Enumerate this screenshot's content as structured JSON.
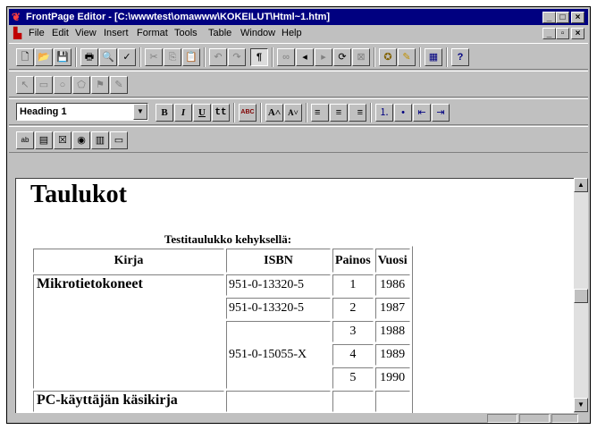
{
  "window": {
    "title": "FrontPage Editor - [C:\\wwwtest\\omawww\\KOKEILUT\\Html~1.htm]",
    "controls": {
      "minimize": "_",
      "maximize": "□",
      "close": "×"
    }
  },
  "menu": {
    "items": [
      "File",
      "Edit",
      "View",
      "Insert",
      "Format",
      "Tools",
      "Table",
      "Window",
      "Help"
    ],
    "doc_controls": {
      "minimize": "_",
      "restore": "▫",
      "close": "×"
    }
  },
  "toolbar_standard": [
    {
      "name": "new-icon",
      "glyph": "🗋"
    },
    {
      "name": "open-icon",
      "glyph": "📂"
    },
    {
      "name": "save-icon",
      "glyph": "💾"
    },
    {
      "name": "print-icon",
      "glyph": "🖶"
    },
    {
      "name": "print-preview-icon",
      "glyph": "🔍"
    },
    {
      "name": "spelling-icon",
      "glyph": "✓"
    },
    {
      "name": "cut-icon",
      "glyph": "✂"
    },
    {
      "name": "copy-icon",
      "glyph": "⎘"
    },
    {
      "name": "paste-icon",
      "glyph": "📋"
    },
    {
      "name": "undo-icon",
      "glyph": "↶"
    },
    {
      "name": "redo-icon",
      "glyph": "↷"
    },
    {
      "name": "show-marks-icon",
      "glyph": "¶"
    },
    {
      "name": "link-icon",
      "glyph": "∞"
    },
    {
      "name": "back-icon",
      "glyph": "◂"
    },
    {
      "name": "forward-icon",
      "glyph": "▸"
    },
    {
      "name": "refresh-icon",
      "glyph": "⟳"
    },
    {
      "name": "stop-icon",
      "glyph": "⊠"
    },
    {
      "name": "explorer-icon",
      "glyph": "✪"
    },
    {
      "name": "editor-icon",
      "glyph": "✎"
    },
    {
      "name": "table-icon",
      "glyph": "▦"
    },
    {
      "name": "help-icon",
      "glyph": "?"
    }
  ],
  "toolbar_image": [
    {
      "name": "pointer-icon",
      "glyph": "↖"
    },
    {
      "name": "rectangle-icon",
      "glyph": "▭"
    },
    {
      "name": "circle-icon",
      "glyph": "○"
    },
    {
      "name": "polygon-icon",
      "glyph": "⬠"
    },
    {
      "name": "highlight-hotspots-icon",
      "glyph": "⚑"
    },
    {
      "name": "make-transparent-icon",
      "glyph": "✎"
    }
  ],
  "toolbar_format": {
    "style_value": "Heading 1",
    "buttons": [
      {
        "name": "bold-button",
        "glyph": "B"
      },
      {
        "name": "italic-button",
        "glyph": "I"
      },
      {
        "name": "underline-button",
        "glyph": "U"
      },
      {
        "name": "typewriter-button",
        "glyph": "tt"
      },
      {
        "name": "text-color-button",
        "glyph": "ABC"
      },
      {
        "name": "increase-text-size-button",
        "glyph": "A˄"
      },
      {
        "name": "decrease-text-size-button",
        "glyph": "A˅"
      },
      {
        "name": "align-left-button",
        "glyph": "≡"
      },
      {
        "name": "align-center-button",
        "glyph": "≡"
      },
      {
        "name": "align-right-button",
        "glyph": "≡"
      },
      {
        "name": "numbered-list-button",
        "glyph": "⒈"
      },
      {
        "name": "bulleted-list-button",
        "glyph": "•"
      },
      {
        "name": "decrease-indent-button",
        "glyph": "⇤"
      },
      {
        "name": "increase-indent-button",
        "glyph": "⇥"
      }
    ]
  },
  "toolbar_forms": [
    {
      "name": "one-line-textbox-icon",
      "glyph": "ab"
    },
    {
      "name": "scrolling-textbox-icon",
      "glyph": "▤"
    },
    {
      "name": "checkbox-icon",
      "glyph": "☒"
    },
    {
      "name": "radio-button-icon",
      "glyph": "◉"
    },
    {
      "name": "drop-down-menu-icon",
      "glyph": "▥"
    },
    {
      "name": "push-button-icon",
      "glyph": "▭"
    }
  ],
  "page": {
    "heading": "Taulukot",
    "caption": "Testitaulukko kehyksellä:",
    "table": {
      "headers": [
        "Kirja",
        "ISBN",
        "Painos",
        "Vuosi"
      ],
      "book1": "Mikrotietokoneet",
      "isbn1": "951-0-13320-5",
      "isbn2": "951-0-15055-X",
      "rows": [
        {
          "painos": "1",
          "vuosi": "1986"
        },
        {
          "painos": "2",
          "vuosi": "1987"
        },
        {
          "painos": "3",
          "vuosi": "1988"
        },
        {
          "painos": "4",
          "vuosi": "1989"
        },
        {
          "painos": "5",
          "vuosi": "1990"
        }
      ],
      "book2_partial": "PC-käyttäjän käsikirja"
    }
  }
}
